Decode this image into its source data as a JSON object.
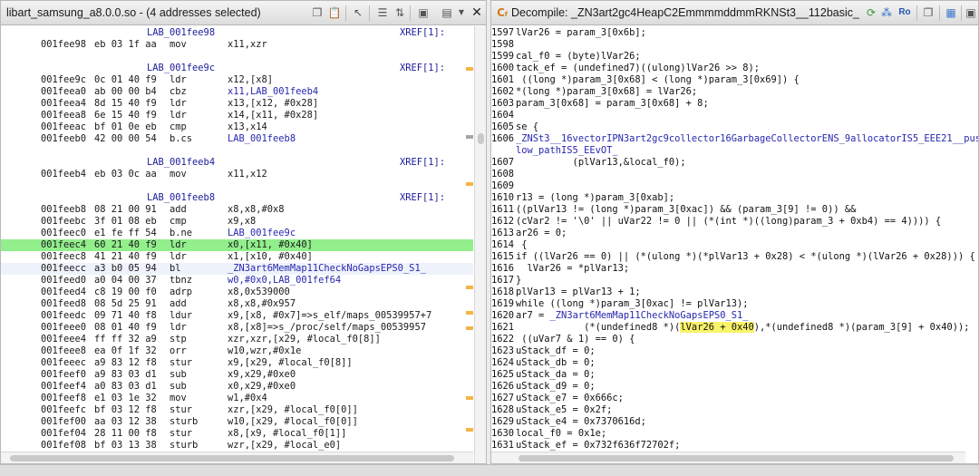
{
  "left": {
    "title": "libart_samsung_a8.0.0.so - (4 addresses selected)",
    "rows": [
      {
        "kind": "label",
        "label": "LAB_001fee98",
        "xref": "XREF[1]:"
      },
      {
        "kind": "ins",
        "addr": "001fee98",
        "bytes": "eb 03 1f aa",
        "mnem": "mov",
        "ops": "x11,xzr"
      },
      {
        "kind": "blank"
      },
      {
        "kind": "label",
        "label": "LAB_001fee9c",
        "xref": "XREF[1]:"
      },
      {
        "kind": "ins",
        "addr": "001fee9c",
        "bytes": "0c 01 40 f9",
        "mnem": "ldr",
        "ops": "x12,[x8]"
      },
      {
        "kind": "ins",
        "addr": "001feea0",
        "bytes": "ab 00 00 b4",
        "mnem": "cbz",
        "ops": "x11,LAB_001feeb4"
      },
      {
        "kind": "ins",
        "addr": "001feea4",
        "bytes": "8d 15 40 f9",
        "mnem": "ldr",
        "ops": "x13,[x12, #0x28]"
      },
      {
        "kind": "ins",
        "addr": "001feea8",
        "bytes": "6e 15 40 f9",
        "mnem": "ldr",
        "ops": "x14,[x11, #0x28]"
      },
      {
        "kind": "ins",
        "addr": "001feeac",
        "bytes": "bf 01 0e eb",
        "mnem": "cmp",
        "ops": "x13,x14"
      },
      {
        "kind": "ins",
        "addr": "001feeb0",
        "bytes": "42 00 00 54",
        "mnem": "b.cs",
        "ops": "LAB_001feeb8"
      },
      {
        "kind": "blank"
      },
      {
        "kind": "label",
        "label": "LAB_001feeb4",
        "xref": "XREF[1]:"
      },
      {
        "kind": "ins",
        "addr": "001feeb4",
        "bytes": "eb 03 0c aa",
        "mnem": "mov",
        "ops": "x11,x12"
      },
      {
        "kind": "blank"
      },
      {
        "kind": "label",
        "label": "LAB_001feeb8",
        "xref": "XREF[1]:"
      },
      {
        "kind": "ins",
        "addr": "001feeb8",
        "bytes": "08 21 00 91",
        "mnem": "add",
        "ops": "x8,x8,#0x8"
      },
      {
        "kind": "ins",
        "addr": "001feebc",
        "bytes": "3f 01 08 eb",
        "mnem": "cmp",
        "ops": "x9,x8"
      },
      {
        "kind": "ins",
        "addr": "001feec0",
        "bytes": "e1 fe ff 54",
        "mnem": "b.ne",
        "ops": "LAB_001fee9c"
      },
      {
        "kind": "ins",
        "addr": "001feec4",
        "bytes": "60 21 40 f9",
        "mnem": "ldr",
        "ops": "x0,[x11, #0x40]",
        "hl": "green"
      },
      {
        "kind": "ins",
        "addr": "001feec8",
        "bytes": "41 21 40 f9",
        "mnem": "ldr",
        "ops": "x1,[x10, #0x40]"
      },
      {
        "kind": "ins",
        "addr": "001feecc",
        "bytes": "a3 b0 05 94",
        "mnem": "bl",
        "ops": "_ZN3art6MemMap11CheckNoGapsEPS0_S1_",
        "hl": "blue"
      },
      {
        "kind": "ins",
        "addr": "001feed0",
        "bytes": "a0 04 00 37",
        "mnem": "tbnz",
        "ops": "w0,#0x0,LAB_001fef64"
      },
      {
        "kind": "ins",
        "addr": "001feed4",
        "bytes": "c8 19 00 f0",
        "mnem": "adrp",
        "ops": "x8,0x539000"
      },
      {
        "kind": "ins",
        "addr": "001feed8",
        "bytes": "08 5d 25 91",
        "mnem": "add",
        "ops": "x8,x8,#0x957"
      },
      {
        "kind": "ins",
        "addr": "001feedc",
        "bytes": "09 71 40 f8",
        "mnem": "ldur",
        "ops": "x9,[x8, #0x7]=>s_elf/maps_00539957+7"
      },
      {
        "kind": "ins",
        "addr": "001feee0",
        "bytes": "08 01 40 f9",
        "mnem": "ldr",
        "ops": "x8,[x8]=>s_/proc/self/maps_00539957"
      },
      {
        "kind": "ins",
        "addr": "001feee4",
        "bytes": "ff ff 32 a9",
        "mnem": "stp",
        "ops": "xzr,xzr,[x29, #local_f0[8]]"
      },
      {
        "kind": "ins",
        "addr": "001feee8",
        "bytes": "ea 0f 1f 32",
        "mnem": "orr",
        "ops": "w10,wzr,#0x1e"
      },
      {
        "kind": "ins",
        "addr": "001feeec",
        "bytes": "a9 83 12 f8",
        "mnem": "stur",
        "ops": "x9,[x29, #local_f0[8]]"
      },
      {
        "kind": "ins",
        "addr": "001feef0",
        "bytes": "a9 83 03 d1",
        "mnem": "sub",
        "ops": "x9,x29,#0xe0"
      },
      {
        "kind": "ins",
        "addr": "001feef4",
        "bytes": "a0 83 03 d1",
        "mnem": "sub",
        "ops": "x0,x29,#0xe0"
      },
      {
        "kind": "ins",
        "addr": "001feef8",
        "bytes": "e1 03 1e 32",
        "mnem": "mov",
        "ops": "w1,#0x4"
      },
      {
        "kind": "ins",
        "addr": "001feefc",
        "bytes": "bf 03 12 f8",
        "mnem": "stur",
        "ops": "xzr,[x29, #local_f0[0]]"
      },
      {
        "kind": "ins",
        "addr": "001fef00",
        "bytes": "aa 03 12 38",
        "mnem": "sturb",
        "ops": "w10,[x29, #local_f0[0]]"
      },
      {
        "kind": "ins",
        "addr": "001fef04",
        "bytes": "28 11 00 f8",
        "mnem": "stur",
        "ops": "x8,[x9, #local_f0[1]]"
      },
      {
        "kind": "ins",
        "addr": "001fef08",
        "bytes": "bf 03 13 38",
        "mnem": "sturb",
        "ops": "wzr,[x29, #local_e0]"
      }
    ]
  },
  "right": {
    "title": "Decompile: _ZN3art2gc4HeapC2EmmmmddmmRKNSt3__112basic_...",
    "rows": [
      {
        "n": "1597",
        "t": "lVar26 = param_3[0x6b];"
      },
      {
        "n": "1598",
        "t": ""
      },
      {
        "n": "1599",
        "t": "cal_f0 = (byte)lVar26;"
      },
      {
        "n": "1600",
        "t": "tack_ef = (undefined7)((ulong)lVar26 >> 8);"
      },
      {
        "n": "1601",
        "t": " ((long *)param_3[0x68] < (long *)param_3[0x69]) {"
      },
      {
        "n": "1602",
        "t": "*(long *)param_3[0x68] = lVar26;"
      },
      {
        "n": "1603",
        "t": "param_3[0x68] = param_3[0x68] + 8;"
      },
      {
        "n": "1604",
        "t": ""
      },
      {
        "n": "1605",
        "t": "se {"
      },
      {
        "n": "1606",
        "t": "_ZNSt3__16vectorIPN3art2gc9collector16GarbageCollectorENS_9allocatorIS5_EEE21__push_back_",
        "blue": true
      },
      {
        "n": "",
        "t": "low_pathIS5_EEvOT_",
        "blue": true
      },
      {
        "n": "1607",
        "t": "          (plVar13,&local_f0);"
      },
      {
        "n": "1608",
        "t": ""
      },
      {
        "n": "1609",
        "t": ""
      },
      {
        "n": "1610",
        "t": "r13 = (long *)param_3[0xab];"
      },
      {
        "n": "1611",
        "t": "((plVar13 != (long *)param_3[0xac]) && (param_3[9] != 0)) &&"
      },
      {
        "n": "1612",
        "t": "(cVar2 != '\\0' || uVar22 != 0 || (*(int *)((long)param_3 + 0xb4) == 4)))) {"
      },
      {
        "n": "1613",
        "t": "ar26 = 0;"
      },
      {
        "n": "1614",
        "t": " {"
      },
      {
        "n": "1615",
        "t": "if ((lVar26 == 0) || (*(ulong *)(*plVar13 + 0x28) < *(ulong *)(lVar26 + 0x28))) {"
      },
      {
        "n": "1616",
        "t": "  lVar26 = *plVar13;"
      },
      {
        "n": "1617",
        "t": "}"
      },
      {
        "n": "1618",
        "t": "plVar13 = plVar13 + 1;"
      },
      {
        "n": "1619",
        "t": "while ((long *)param_3[0xac] != plVar13);"
      },
      {
        "n": "1620",
        "t": "ar7 = _ZN3art6MemMap11CheckNoGapsEPS0_S1_",
        "callpart": true
      },
      {
        "n": "1621",
        "t": "            (*(undefined8 *)(",
        "hlA": "lVar26 + 0x40",
        "tB": "),*(undefined8 *)(param_3[9] + 0x40));"
      },
      {
        "n": "1622",
        "t": " ((uVar7 & 1) == 0) {"
      },
      {
        "n": "1623",
        "t": "uStack_df = 0;"
      },
      {
        "n": "1624",
        "t": "uStack_db = 0;"
      },
      {
        "n": "1625",
        "t": "uStack_da = 0;"
      },
      {
        "n": "1626",
        "t": "uStack_d9 = 0;"
      },
      {
        "n": "1627",
        "t": "uStack_e7 = 0x666c;"
      },
      {
        "n": "1628",
        "t": "uStack_e5 = 0x2f;"
      },
      {
        "n": "1629",
        "t": "uStack_e4 = 0x7370616d;"
      },
      {
        "n": "1630",
        "t": "local_f0 = 0x1e;"
      },
      {
        "n": "1631",
        "t": "uStack_ef = 0x732f636f72702f;"
      }
    ]
  },
  "icons": {
    "left_toolbar": [
      "copy-icon",
      "paste-icon",
      "cursor-icon",
      "listing-fields-icon",
      "cpu-icon",
      "menu-icon",
      "close-icon"
    ],
    "right_toolbar": [
      "refresh-icon",
      "graph-icon",
      "ro-icon",
      "copy-icon",
      "export-icon",
      "cpu-icon",
      "menu-icon"
    ]
  }
}
